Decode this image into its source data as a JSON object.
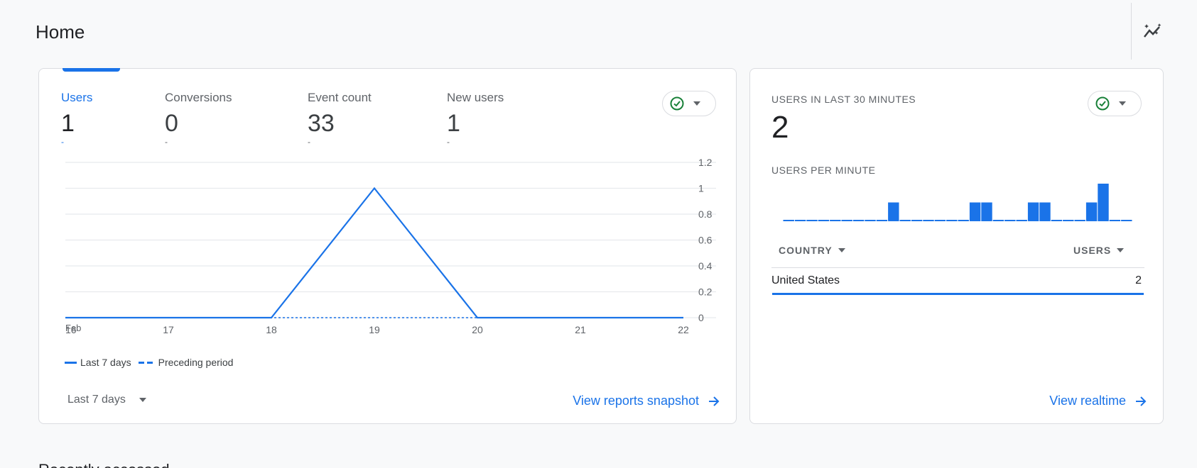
{
  "page": {
    "title": "Home",
    "insights_icon": "auto-insights-icon",
    "below_fold_heading": "Recently accessed"
  },
  "main_card": {
    "metrics": [
      {
        "label": "Users",
        "value": "1",
        "delta": "-",
        "active": true
      },
      {
        "label": "Conversions",
        "value": "0",
        "delta": "-",
        "active": false
      },
      {
        "label": "Event count",
        "value": "33",
        "delta": "-",
        "active": false
      },
      {
        "label": "New users",
        "value": "1",
        "delta": "-",
        "active": false
      }
    ],
    "status_icon": "check-circle-icon",
    "legend": {
      "current": "Last 7 days",
      "previous": "Preceding period"
    },
    "date_range": "Last 7 days",
    "link": "View reports snapshot"
  },
  "chart_data": {
    "type": "line",
    "x": [
      "16",
      "17",
      "18",
      "19",
      "20",
      "21",
      "22"
    ],
    "x_sublabel": "Feb",
    "series": [
      {
        "name": "Last 7 days",
        "values": [
          0,
          0,
          0,
          1,
          0,
          0,
          0
        ],
        "style": "solid"
      },
      {
        "name": "Preceding period",
        "values": [
          0,
          0,
          0,
          0,
          0,
          0,
          0
        ],
        "style": "dashed"
      }
    ],
    "y_ticks": [
      "0",
      "0.2",
      "0.4",
      "0.6",
      "0.8",
      "1",
      "1.2"
    ],
    "ylim": [
      0,
      1.2
    ],
    "color": "#1a73e8",
    "grid": true
  },
  "realtime_card": {
    "title": "USERS IN LAST 30 MINUTES",
    "value": "2",
    "subtitle": "USERS PER MINUTE",
    "per_minute": [
      0,
      0,
      0,
      0,
      0,
      0,
      0,
      0,
      0,
      1,
      0,
      0,
      0,
      0,
      0,
      0,
      1,
      1,
      0,
      0,
      0,
      1,
      1,
      0,
      0,
      0,
      1,
      2,
      0,
      0
    ],
    "col_country": "COUNTRY",
    "col_users": "USERS",
    "rows": [
      {
        "country": "United States",
        "users": "2"
      }
    ],
    "link": "View realtime",
    "status_icon": "check-circle-icon"
  },
  "colors": {
    "accent": "#1a73e8",
    "success": "#188038"
  }
}
